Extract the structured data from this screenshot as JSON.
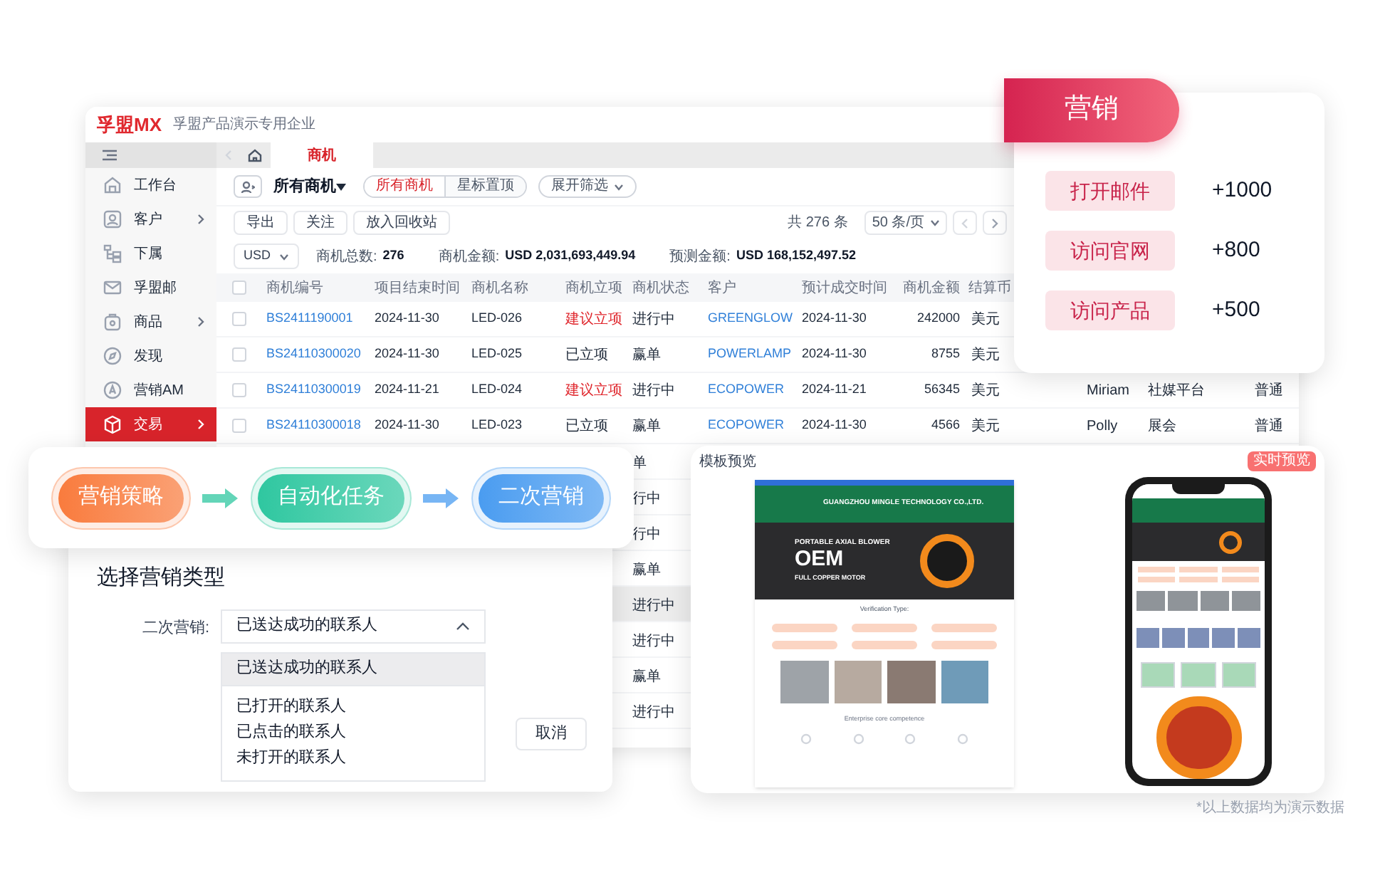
{
  "app": {
    "logo": "孚盟MX",
    "company": "孚盟产品演示专用企业",
    "tabs": [
      {
        "label": "商机",
        "selected": true
      }
    ],
    "sidebar": [
      {
        "label": "工作台",
        "has_submenu": false,
        "selected": false
      },
      {
        "label": "客户",
        "has_submenu": true,
        "selected": false
      },
      {
        "label": "下属",
        "has_submenu": false,
        "selected": false
      },
      {
        "label": "孚盟邮",
        "has_submenu": false,
        "selected": false
      },
      {
        "label": "商品",
        "has_submenu": true,
        "selected": false
      },
      {
        "label": "发现",
        "has_submenu": false,
        "selected": false
      },
      {
        "label": "营销AM",
        "has_submenu": false,
        "selected": false
      },
      {
        "label": "交易",
        "has_submenu": true,
        "selected": true
      }
    ],
    "view_title": "所有商机",
    "segments": [
      {
        "label": "所有商机",
        "selected": true
      },
      {
        "label": "星标置顶",
        "selected": false
      }
    ],
    "filter_button": "展开筛选",
    "actions": [
      "导出",
      "关注",
      "放入回收站"
    ],
    "total": "共 276 条",
    "page_size": "50 条/页",
    "currency": "USD",
    "stats": [
      {
        "label": "商机总数:",
        "value": "276"
      },
      {
        "label": "商机金额:",
        "value": "USD 2,031,693,449.94"
      },
      {
        "label": "预测金额:",
        "value": "USD 168,152,497.52"
      }
    ],
    "table": {
      "select_all_checked": false,
      "columns": [
        "商机编号",
        "项目结束时间",
        "商机名称",
        "商机立项",
        "商机状态",
        "客户",
        "预计成交时间",
        "商机金额",
        "结算币"
      ],
      "rows": [
        {
          "checked": false,
          "id": "BS2411190001",
          "end_date": "2024-11-30",
          "name": "LED-026",
          "approval": {
            "text": "建议立项",
            "kind": "suggested"
          },
          "status": "进行中",
          "customer": "GREENGLOW",
          "expected_date": "2024-11-30",
          "amount": "242000",
          "currency": "美元"
        },
        {
          "checked": false,
          "id": "BS24110300020",
          "end_date": "2024-11-30",
          "name": "LED-025",
          "approval": {
            "text": "已立项",
            "kind": "approved"
          },
          "status": "赢单",
          "customer": "POWERLAMP",
          "expected_date": "2024-11-30",
          "amount": "8755",
          "currency": "美元"
        },
        {
          "checked": false,
          "id": "BS24110300019",
          "end_date": "2024-11-21",
          "name": "LED-024",
          "approval": {
            "text": "建议立项",
            "kind": "suggested"
          },
          "status": "进行中",
          "customer": "ECOPOWER",
          "expected_date": "2024-11-21",
          "amount": "56345",
          "currency": "美元",
          "column_12": "Miriam",
          "column_13": "社媒平台",
          "column_14": "普通"
        },
        {
          "checked": false,
          "id": "BS24110300018",
          "end_date": "2024-11-30",
          "name": "LED-023",
          "approval": {
            "text": "已立项",
            "kind": "approved"
          },
          "status": "赢单",
          "customer": "ECOPOWER",
          "expected_date": "2024-11-30",
          "amount": "4566",
          "currency": "美元",
          "column_12": "Polly",
          "column_13": "展会",
          "column_14": "普通"
        }
      ],
      "more_status": [
        {
          "text": "单",
          "highlighted": false
        },
        {
          "text": "行中",
          "highlighted": false
        },
        {
          "text": "行中",
          "highlighted": false
        },
        {
          "text": "赢单",
          "highlighted": false
        },
        {
          "text": "进行中",
          "highlighted": true
        },
        {
          "text": "进行中",
          "highlighted": false
        },
        {
          "text": "赢单",
          "highlighted": false
        },
        {
          "text": "进行中",
          "highlighted": false
        }
      ]
    }
  },
  "marketing_card": {
    "title": "营销",
    "items": [
      {
        "label": "打开邮件",
        "value": "+1000"
      },
      {
        "label": "访问官网",
        "value": "+800"
      },
      {
        "label": "访问产品",
        "value": "+500"
      }
    ]
  },
  "flow": [
    {
      "label": "营销策略",
      "color": "#f97b3d"
    },
    {
      "label": "自动化任务",
      "color": "#2fc7a0"
    },
    {
      "label": "二次营销",
      "color": "#4a9cf0"
    }
  ],
  "dialog": {
    "title": "选择营销类型",
    "field_label": "二次营销:",
    "value": "已送达成功的联系人",
    "expanded": true,
    "options": [
      {
        "label": "已送达成功的联系人",
        "selected": true
      },
      {
        "label": "已打开的联系人",
        "selected": false
      },
      {
        "label": "已点击的联系人",
        "selected": false
      },
      {
        "label": "未打开的联系人",
        "selected": false
      }
    ],
    "cancel": "取消"
  },
  "template_preview": {
    "title": "模板预览",
    "button": "实时预览",
    "site": {
      "company": "GUANGZHOU MINGLE TECHNOLOGY CO.,LTD.",
      "hero_lines": [
        "PORTABLE AXIAL BLOWER",
        "OEM",
        "FULL COPPER MOTOR"
      ],
      "verification": "Verification Type:",
      "section_title": "Enterprise core competence"
    }
  },
  "footnote": "*以上数据均为演示数据"
}
